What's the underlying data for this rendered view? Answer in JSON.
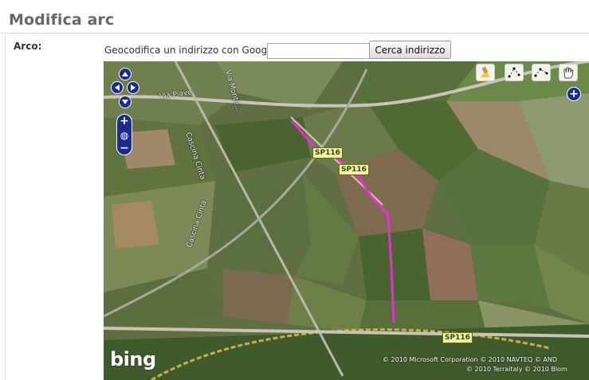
{
  "page": {
    "title": "Modifica arc"
  },
  "form": {
    "field_label": "Arco:",
    "geocode_label": "Geocodifica un indirizzo con Google",
    "address_input": {
      "value": "",
      "placeholder": ""
    },
    "search_button": "Cerca indirizzo"
  },
  "map": {
    "provider_logo": "bing",
    "copyright_line1": "© 2010 Microsoft Corporation   © 2010 NAVTEQ   © AND",
    "copyright_line2": "© 2010 Terraitaly   © 2010 Blom",
    "street_labels": [
      "Via Piave",
      "Cascina Cinta",
      "Cascina Cinta",
      "Via Monte..."
    ],
    "road_tags": [
      "SP116",
      "SP116",
      "SP116"
    ],
    "route_color": "#e52fd6",
    "controls": {
      "pan": [
        "pan-up",
        "pan-left",
        "pan-right",
        "pan-down"
      ],
      "zoom": [
        "zoom-in",
        "zoom-world",
        "zoom-out"
      ],
      "tools": [
        "eraser-icon",
        "draw-point-icon",
        "draw-line-icon",
        "hand-icon"
      ],
      "layer_switch_symbol": "+"
    }
  }
}
